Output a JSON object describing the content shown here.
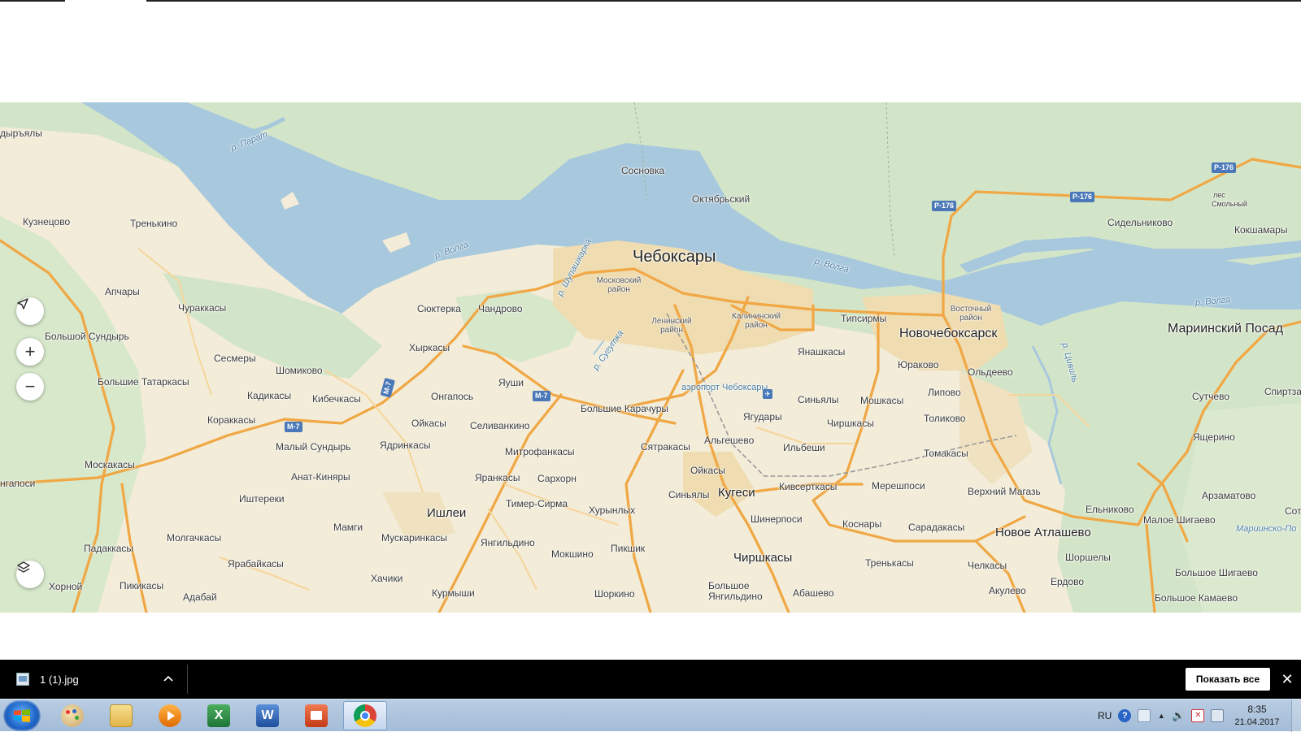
{
  "map": {
    "cities_major": {
      "cheboksary": "Чебоксары",
      "novocheboksarsk": "Новочебоксарск",
      "mariinsky_posad": "Мариинский Посад",
      "kugesi": "Кугеси",
      "chirshkasy_south": "Чиршкасы",
      "ishlei": "Ишлеи",
      "novoe_atlashevo": "Новое Атлашево"
    },
    "districts": {
      "moskovsky": "Московский район",
      "leninsky": "Ленинский район",
      "kalininsky": "Калининский район",
      "vostochny": "Восточный район"
    },
    "places": [
      {
        "id": "dyaryaly",
        "name": "дыръялы"
      },
      {
        "id": "kuznetsovo",
        "name": "Кузнецово"
      },
      {
        "id": "trenkino",
        "name": "Тренькино"
      },
      {
        "id": "sosnovka",
        "name": "Сосновка"
      },
      {
        "id": "oktyabrsky",
        "name": "Октябрьский"
      },
      {
        "id": "sidelnikovo",
        "name": "Сидельниково"
      },
      {
        "id": "kokshamary",
        "name": "Кокшамары"
      },
      {
        "id": "apchary",
        "name": "Апчары"
      },
      {
        "id": "churakkasy",
        "name": "Чураккасы"
      },
      {
        "id": "bolshoy_sundyr",
        "name": "Большой Сундырь"
      },
      {
        "id": "syukterka",
        "name": "Сюктерка"
      },
      {
        "id": "chandrovo",
        "name": "Чандрово"
      },
      {
        "id": "tipsirmy",
        "name": "Типсирмы"
      },
      {
        "id": "sesmery",
        "name": "Сесмеры"
      },
      {
        "id": "shomikovo",
        "name": "Шомиково"
      },
      {
        "id": "khyrkasy",
        "name": "Хыркасы"
      },
      {
        "id": "yanashkasy",
        "name": "Янашкасы"
      },
      {
        "id": "bolshie_tatarkasy",
        "name": "Большие Татаркасы"
      },
      {
        "id": "yushi",
        "name": "Яуши"
      },
      {
        "id": "yurakovo",
        "name": "Юраково"
      },
      {
        "id": "oldeevo",
        "name": "Ольдеево"
      },
      {
        "id": "kadikasy",
        "name": "Кадикасы"
      },
      {
        "id": "kibechkasy",
        "name": "Кибечкасы"
      },
      {
        "id": "ongapos",
        "name": "Онгапось"
      },
      {
        "id": "sinyaly_n",
        "name": "Синьялы"
      },
      {
        "id": "moshkasy",
        "name": "Мошкасы"
      },
      {
        "id": "lipovo",
        "name": "Липово"
      },
      {
        "id": "sutchevo",
        "name": "Сутчево"
      },
      {
        "id": "spirtzavod",
        "name": "Спиртзав"
      },
      {
        "id": "korakkasy",
        "name": "Кораккасы"
      },
      {
        "id": "oikasy_w",
        "name": "Ойкасы"
      },
      {
        "id": "selivankino",
        "name": "Селиванкино"
      },
      {
        "id": "bolshie_karachury",
        "name": "Большие Карачуры"
      },
      {
        "id": "yagudary",
        "name": "Ягудары"
      },
      {
        "id": "chirshkasy_n",
        "name": "Чиршкасы"
      },
      {
        "id": "tolikovo",
        "name": "Толиково"
      },
      {
        "id": "malyi_sundyr",
        "name": "Малый Сундырь"
      },
      {
        "id": "yadrinkasy",
        "name": "Ядринкасы"
      },
      {
        "id": "mitrofankasy",
        "name": "Митрофанкасы"
      },
      {
        "id": "syatrakasy",
        "name": "Сятракасы"
      },
      {
        "id": "algeshevo",
        "name": "Альгешево"
      },
      {
        "id": "ilbeshi",
        "name": "Ильбеши"
      },
      {
        "id": "yashcherino",
        "name": "Ящерино"
      },
      {
        "id": "tomakasy",
        "name": "Томакасы"
      },
      {
        "id": "moskakasy",
        "name": "Москакасы"
      },
      {
        "id": "oikasy_s",
        "name": "Ойкасы"
      },
      {
        "id": "anat_kinyary",
        "name": "Анат-Киняры"
      },
      {
        "id": "yarankasy",
        "name": "Яранкасы"
      },
      {
        "id": "sarkhorn",
        "name": "Сархорн"
      },
      {
        "id": "ngaposi",
        "name": "нгапоси"
      },
      {
        "id": "kivsertkasy",
        "name": "Кивсерткасы"
      },
      {
        "id": "mereshposi",
        "name": "Мерешпоси"
      },
      {
        "id": "verkhny_magaz",
        "name": "Верхний Магазь"
      },
      {
        "id": "arzamatovo",
        "name": "Арзаматово"
      },
      {
        "id": "ishtereki",
        "name": "Иштереки"
      },
      {
        "id": "sinyaly_s",
        "name": "Синьялы"
      },
      {
        "id": "timer_sirma",
        "name": "Тимер-Сирма"
      },
      {
        "id": "elnikovo",
        "name": "Ельниково"
      },
      {
        "id": "khurynlykh",
        "name": "Хурынлых"
      },
      {
        "id": "shinerposi",
        "name": "Шинерпоси"
      },
      {
        "id": "malye_shigaevo",
        "name": "Малое Шигаево"
      },
      {
        "id": "sots",
        "name": "Сот"
      },
      {
        "id": "mamgi",
        "name": "Мамги"
      },
      {
        "id": "koshnary",
        "name": "Коснары"
      },
      {
        "id": "saradakasy",
        "name": "Сарадакасы"
      },
      {
        "id": "molgachkasy",
        "name": "Молгачкасы"
      },
      {
        "id": "muskarinkasy",
        "name": "Мускаринкасы"
      },
      {
        "id": "yangildino",
        "name": "Янгильдино"
      },
      {
        "id": "mariinsko_pos",
        "name": "Мариинско-По"
      },
      {
        "id": "padakkasy",
        "name": "Падаккасы"
      },
      {
        "id": "pikshik",
        "name": "Пикшик"
      },
      {
        "id": "mokshino",
        "name": "Мокшино"
      },
      {
        "id": "shorshely",
        "name": "Шоршелы"
      },
      {
        "id": "yarabaikasy",
        "name": "Ярабайкасы"
      },
      {
        "id": "trenkasy",
        "name": "Тренькасы"
      },
      {
        "id": "chelkasy",
        "name": "Челкасы"
      },
      {
        "id": "bolshoe_shigaevo",
        "name": "Большое Шигаево"
      },
      {
        "id": "khachiki",
        "name": "Хачики"
      },
      {
        "id": "erdovo",
        "name": "Ердово"
      },
      {
        "id": "khorny",
        "name": "Хорной"
      },
      {
        "id": "pikikasy",
        "name": "Пикикасы"
      },
      {
        "id": "bolshoe_yangildino_1",
        "name": "Большое"
      },
      {
        "id": "bolshoe_yangildino_2",
        "name": "Янгильдино"
      },
      {
        "id": "akulevo",
        "name": "Акулево"
      },
      {
        "id": "kurmyshi",
        "name": "Курмыши"
      },
      {
        "id": "shorkino",
        "name": "Шоркино"
      },
      {
        "id": "abashevo",
        "name": "Абашево"
      },
      {
        "id": "bolshoe_kamaevo",
        "name": "Большое Камаево"
      },
      {
        "id": "adabai",
        "name": "Адабай"
      },
      {
        "id": "les_1",
        "name": "лес"
      },
      {
        "id": "les_2",
        "name": "Смольный"
      }
    ],
    "rivers": {
      "parat": "р. Парат",
      "volga_w": "р. Волга",
      "volga_c": "р. Волга",
      "volga_e": "р. Волга",
      "shupashkarka": "р. Шупашкарка",
      "sugutka": "р. Сугутка",
      "tsivil": "р. Цивиль"
    },
    "airport": "аэропорт Чебоксары",
    "road_badges": {
      "m7_w": "М-7",
      "m7_c": "М-7",
      "m7_v": "М-7",
      "r176_a": "Р-176",
      "r176_b": "Р-176",
      "r176_c": "Р-176"
    },
    "colors": {
      "water": "#a8c8dd",
      "forest": "#cfe3c4",
      "land": "#f2ecd8",
      "urban": "#f0dfb8",
      "road": "#f0a744"
    },
    "controls": {
      "locate_icon": "navigation-arrow-icon",
      "zoom_in": "+",
      "zoom_out": "−",
      "layers_icon": "layers-icon"
    }
  },
  "downloads": {
    "filename": "1 (1).jpg",
    "show_all": "Показать все",
    "close": "✕",
    "chevron": "^"
  },
  "taskbar": {
    "apps": [
      {
        "id": "paint",
        "icon": "paint-icon"
      },
      {
        "id": "explorer",
        "icon": "folder-icon"
      },
      {
        "id": "media",
        "icon": "media-player-icon"
      },
      {
        "id": "excel",
        "icon": "excel-icon"
      },
      {
        "id": "word",
        "icon": "word-icon"
      },
      {
        "id": "presentation",
        "icon": "presentation-icon"
      },
      {
        "id": "chrome",
        "icon": "chrome-icon"
      }
    ],
    "tray": {
      "lang": "RU",
      "time": "8:35",
      "date": "21.04.2017"
    }
  }
}
